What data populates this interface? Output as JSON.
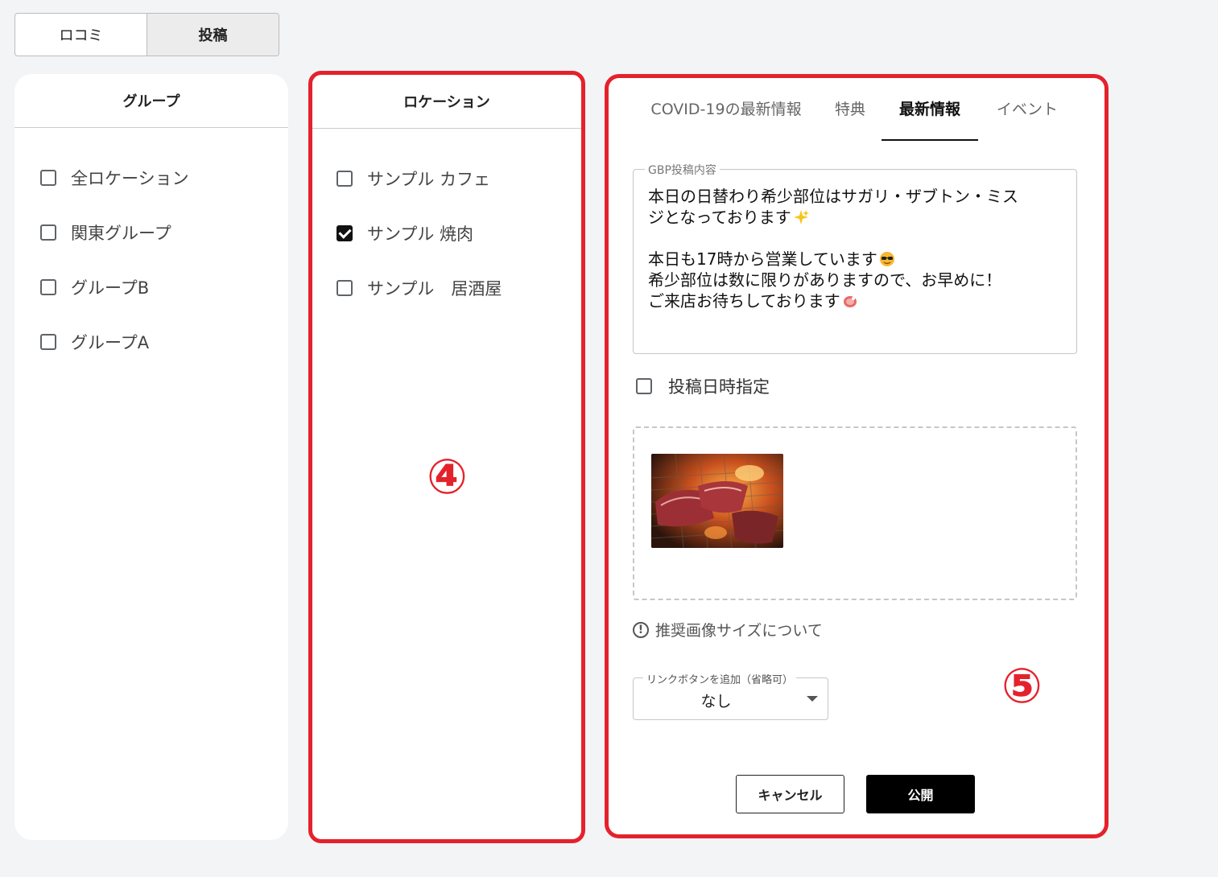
{
  "top_toggle": {
    "reviews": "ロコミ",
    "posts": "投稿"
  },
  "group_panel": {
    "title": "グループ",
    "items": [
      {
        "label": "全ロケーション",
        "checked": false
      },
      {
        "label": "関東グループ",
        "checked": false
      },
      {
        "label": "グループB",
        "checked": false
      },
      {
        "label": "グループA",
        "checked": false
      }
    ]
  },
  "location_panel": {
    "title": "ロケーション",
    "items": [
      {
        "label": "サンプル カフェ",
        "checked": false
      },
      {
        "label": "サンプル 焼肉",
        "checked": true
      },
      {
        "label": "サンプル　居酒屋",
        "checked": false
      }
    ],
    "marker": "④"
  },
  "post_panel": {
    "tabs": [
      "COVID-19の最新情報",
      "特典",
      "最新情報",
      "イベント"
    ],
    "active_tab": "最新情報",
    "content_label": "GBP投稿内容",
    "content_lines": [
      "本日の日替わり希少部位はサガリ・ザブトン・ミス",
      "ジとなっております",
      "",
      "本日も17時から営業しています",
      "希少部位は数に限りがありますので、お早めに！",
      "ご来店お待ちしております"
    ],
    "schedule_label": "投稿日時指定",
    "image_size_info": "推奨画像サイズについて",
    "link_button_label": "リンクボタンを追加（省略可）",
    "link_button_value": "なし",
    "cancel_label": "キャンセル",
    "publish_label": "公開",
    "marker": "⑤"
  },
  "icons": [
    "sparkles-icon",
    "sunglasses-face-icon",
    "meat-icon",
    "info-icon",
    "dropdown-arrow-icon",
    "checkbox-icon"
  ],
  "colors": {
    "highlight_border": "#e4222c",
    "primary_button": "#000000",
    "background": "#f3f4f6"
  }
}
